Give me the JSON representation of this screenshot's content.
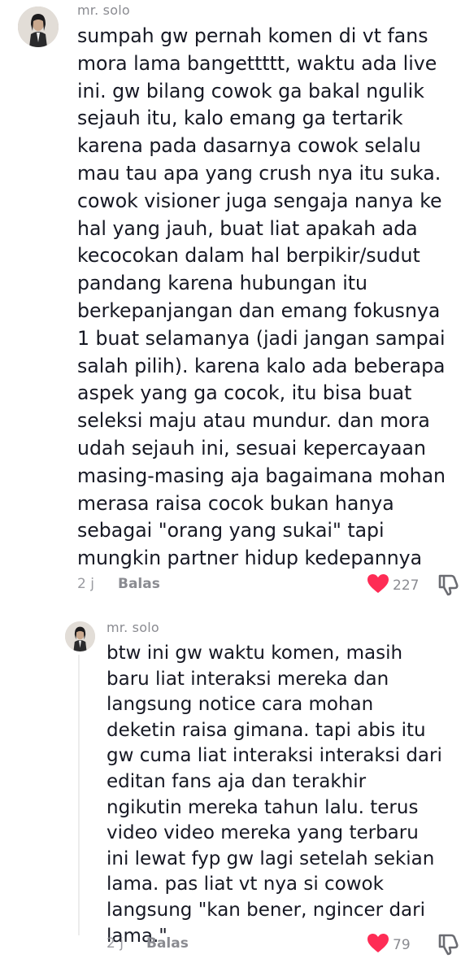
{
  "comments": [
    {
      "username": "mr. solo",
      "text": "sumpah gw pernah komen di vt fans\nmora lama bangettttt, waktu ada live\nini. gw bilang cowok ga bakal ngulik\nsejauh itu, kalo emang ga tertarik\nkarena pada dasarnya cowok selalu\nmau tau apa yang crush nya itu suka.\ncowok visioner juga sengaja nanya ke\nhal yang jauh, buat liat apakah ada\nkecocokan dalam hal berpikir/sudut\npandang karena hubungan itu\nberkepanjangan dan emang fokusnya\n1 buat selamanya (jadi jangan sampai\nsalah pilih). karena kalo ada beberapa\naspek yang ga cocok, itu bisa buat\nseleksi maju atau mundur. dan mora\nudah sejauh ini, sesuai kepercayaan\nmasing-masing aja bagaimana mohan\nmerasa raisa cocok bukan hanya\nsebagai \"orang yang sukai\" tapi\nmungkin partner hidup kedepannya",
      "time": "2 j",
      "reply_label": "Balas",
      "likes": "227",
      "liked_color": "#fe2c55"
    },
    {
      "username": "mr. solo",
      "text": "btw ini gw waktu komen, masih\nbaru liat interaksi mereka dan\nlangsung notice cara mohan\ndeketin raisa gimana. tapi abis itu\ngw cuma liat interaksi interaksi dari\neditan fans aja dan terakhir\nngikutin mereka tahun lalu. terus\nvideo video mereka yang terbaru\nini lewat fyp gw lagi setelah sekian\nlama. pas liat vt nya si cowok\nlangsung \"kan bener, ngincer dari\nlama.\"",
      "time": "2 j",
      "reply_label": "Balas",
      "likes": "79",
      "liked_color": "#fe2c55"
    }
  ],
  "icons": {
    "like": "heart-icon",
    "dislike": "thumbs-down-icon"
  }
}
